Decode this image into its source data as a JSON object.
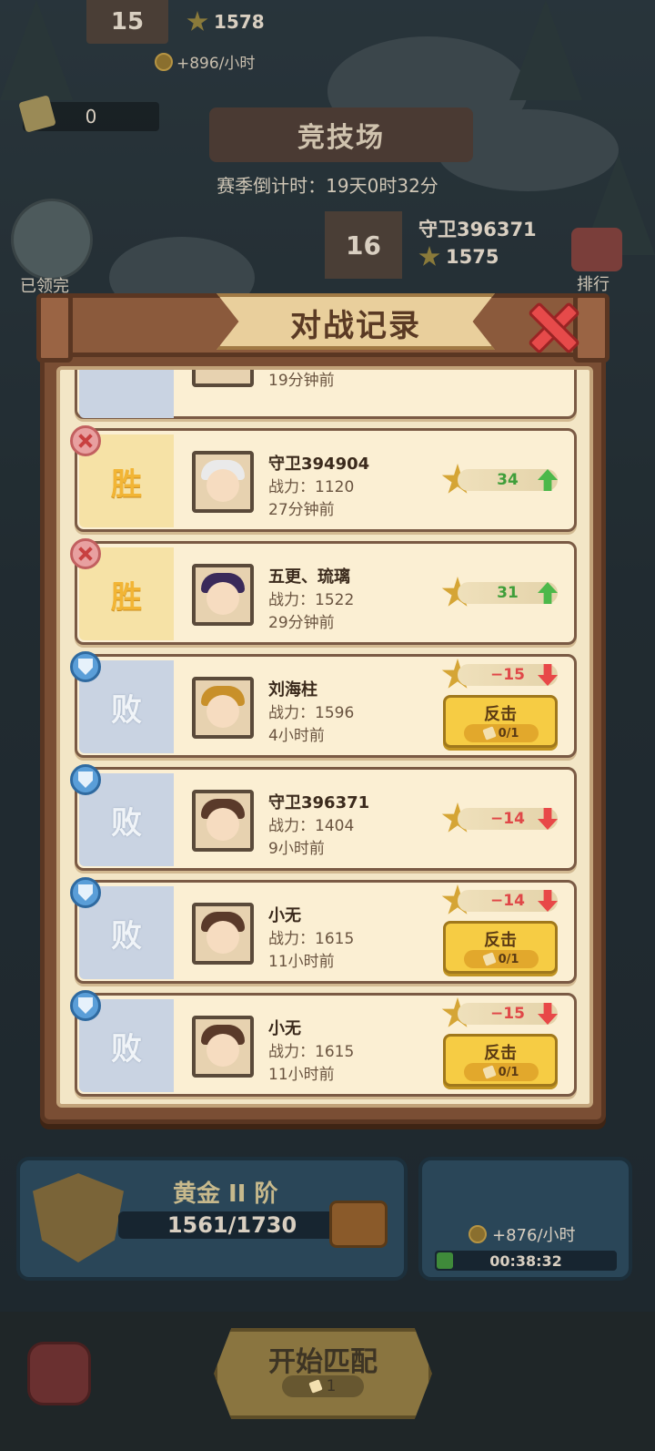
{
  "background": {
    "top_rank": "15",
    "top_score": "1578",
    "top_rate": "+896/小时",
    "ticket_count": "0",
    "arena_title": "竞技场",
    "season_countdown": "赛季倒计时：19天0时32分",
    "claim_label": "已领完",
    "rank16_number": "16",
    "rank16_name": "守卫396371",
    "rank16_score": "1575",
    "rank_label": "排行"
  },
  "bottom": {
    "tier_name": "黄金 II 阶",
    "tier_progress": "1561/1730",
    "income_rate": "+876/小时",
    "income_timer": "00:38:32",
    "match_label": "开始匹配",
    "match_cost": "1"
  },
  "modal": {
    "title": "对战记录",
    "partial_time": "19分钟前",
    "records": [
      {
        "result": "胜",
        "outcome": "win",
        "name": "守卫394904",
        "power": "战力：1120",
        "time": "27分钟前",
        "score": "34",
        "revenge": false,
        "hair": "#eaeaea"
      },
      {
        "result": "胜",
        "outcome": "win",
        "name": "五更、琉璃",
        "power": "战力：1522",
        "time": "29分钟前",
        "score": "31",
        "revenge": false,
        "hair": "#3a2a5a"
      },
      {
        "result": "败",
        "outcome": "loss",
        "name": "刘海柱",
        "power": "战力：1596",
        "time": "4小时前",
        "score": "−15",
        "revenge": true,
        "revenge_label": "反击",
        "revenge_cost": "0/1",
        "hair": "#c8902a"
      },
      {
        "result": "败",
        "outcome": "loss",
        "name": "守卫396371",
        "power": "战力：1404",
        "time": "9小时前",
        "score": "−14",
        "revenge": false,
        "hair": "#5a3a2a"
      },
      {
        "result": "败",
        "outcome": "loss",
        "name": "小无",
        "power": "战力：1615",
        "time": "11小时前",
        "score": "−14",
        "revenge": true,
        "revenge_label": "反击",
        "revenge_cost": "0/1",
        "hair": "#5a3a2a"
      },
      {
        "result": "败",
        "outcome": "loss",
        "name": "小无",
        "power": "战力：1615",
        "time": "11小时前",
        "score": "−15",
        "revenge": true,
        "revenge_label": "反击",
        "revenge_cost": "0/1",
        "hair": "#5a3a2a"
      }
    ]
  }
}
